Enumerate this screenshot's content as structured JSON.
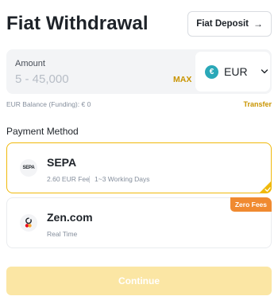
{
  "header": {
    "title": "Fiat Withdrawal",
    "deposit_label": "Fiat Deposit",
    "deposit_icon": "arrow-right-icon"
  },
  "amount": {
    "label": "Amount",
    "placeholder": "5 - 45,000",
    "value": "",
    "max_label": "MAX",
    "currency": {
      "code": "EUR",
      "icon": "euro-icon",
      "symbol": "€",
      "icon_color": "#2aa8b8"
    }
  },
  "balance": {
    "text": "EUR Balance (Funding): € 0",
    "transfer_label": "Transfer"
  },
  "payment": {
    "section_title": "Payment Method",
    "methods": [
      {
        "name": "SEPA",
        "logo_text": "SEPA",
        "fee": "2.60 EUR Fee",
        "time": "1~3 Working Days",
        "selected": true
      },
      {
        "name": "Zen.com",
        "subtitle": "Real Time",
        "badge": "Zero Fees",
        "selected": false
      }
    ]
  },
  "footer": {
    "continue_label": "Continue"
  },
  "colors": {
    "accent": "#f0b90b",
    "link": "#c99400",
    "badge": "#f08a30",
    "button_disabled": "#fbe6a4"
  }
}
